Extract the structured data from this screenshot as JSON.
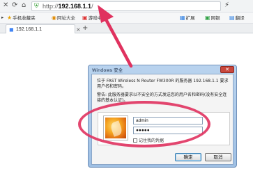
{
  "browser": {
    "address_prefix": "http://",
    "address_host": "192.168.1.1",
    "address_suffix": "/",
    "bookmarks": [
      {
        "label": "手机收藏夹"
      },
      {
        "label": "阿址大全"
      },
      {
        "label": "游戏中心"
      }
    ],
    "right_tools": [
      {
        "label": "扩展"
      },
      {
        "label": "网银"
      },
      {
        "label": "翻译"
      }
    ],
    "tab_title": "192.168.1.1",
    "new_tab": "+",
    "colors": {
      "annotation": "#e0325f"
    }
  },
  "dialog": {
    "title": "Windows 安全",
    "close": "✕",
    "message1": "位于 FAST Wireless N Router FW300R 的服务器 192.168.1.1 要求用户名和密码。",
    "message2": "警告: 此服务器要求以不安全的方式发送您的用户名和密码(没有安全连接的基本认证)。",
    "username": "admin",
    "password": "●●●●●",
    "remember_label": "记住我的凭据",
    "ok_label": "确定",
    "cancel_label": "取消"
  }
}
